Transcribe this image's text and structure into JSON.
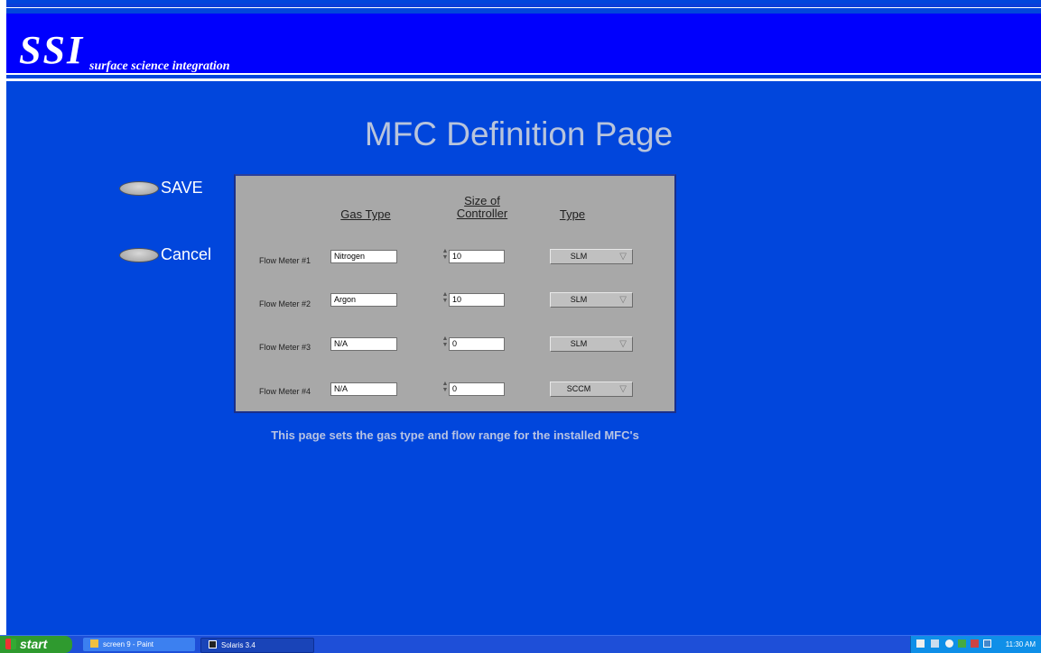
{
  "header": {
    "logo": "SSI",
    "subtitle": "surface science integration"
  },
  "title": "MFC Definition Page",
  "buttons": {
    "save": "SAVE",
    "cancel": "Cancel"
  },
  "table": {
    "headers": {
      "gas_type": "Gas Type",
      "size_line1": "Size of",
      "size_line2": "Controller",
      "type": "Type"
    },
    "rows": [
      {
        "label": "Flow Meter #1",
        "gas": "Nitrogen",
        "size": "10",
        "type": "SLM"
      },
      {
        "label": "Flow Meter #2",
        "gas": "Argon",
        "size": "10",
        "type": "SLM"
      },
      {
        "label": "Flow Meter #3",
        "gas": "N/A",
        "size": "0",
        "type": "SLM"
      },
      {
        "label": "Flow Meter #4",
        "gas": "N/A",
        "size": "0",
        "type": "SCCM"
      }
    ]
  },
  "caption": "This page sets the gas type and flow range for the installed MFC's",
  "taskbar": {
    "start": "start",
    "tasks": [
      {
        "label": "screen 9 - Paint"
      },
      {
        "label": "Solaris 3.4"
      }
    ],
    "clock": "11:30 AM"
  },
  "colors": {
    "background": "#0146dc",
    "header": "#0000fd",
    "panel": "#a8a8a8",
    "taskbar": "#1e4fd8",
    "start": "#2f9a2f"
  }
}
